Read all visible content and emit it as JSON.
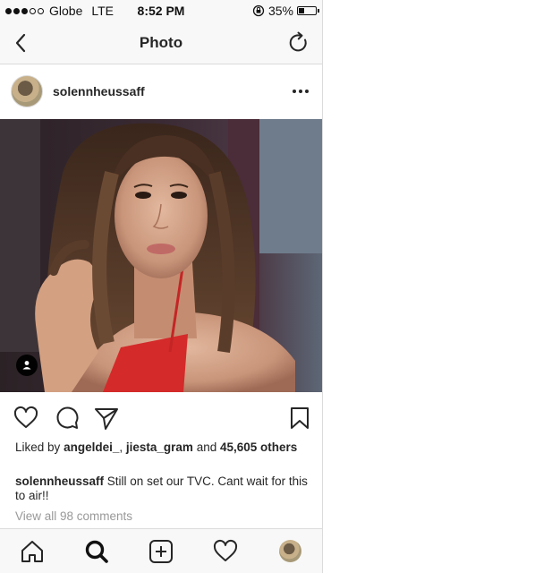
{
  "status_bar": {
    "carrier": "Globe",
    "network": "LTE",
    "time": "8:52 PM",
    "battery": "35%",
    "battery_level": 0.35,
    "signal_bars_filled": 3,
    "signal_bars_total": 5
  },
  "header": {
    "title": "Photo",
    "back_icon": "chevron-left-icon",
    "refresh_icon": "refresh-icon"
  },
  "post": {
    "username": "solennheussaff",
    "more_icon": "more-horizontal-icon",
    "likes": {
      "prefix": "Liked by",
      "user1": "angeldei_",
      "separator": ",",
      "user2": "jiesta_gram",
      "and": "and",
      "count": "45,605",
      "suffix": "others"
    },
    "caption": {
      "user": "solennheussaff",
      "text": "Still on set our TVC. Cant wait for this to air!!"
    },
    "view_comments": "View all 98 comments"
  },
  "actions": {
    "like_icon": "heart-icon",
    "comment_icon": "comment-icon",
    "share_icon": "send-icon",
    "save_icon": "bookmark-icon"
  },
  "tab_bar": {
    "items": [
      "home-icon",
      "search-icon",
      "add-icon",
      "activity-heart-icon",
      "profile-avatar"
    ]
  },
  "colors": {
    "bar_bg": "#f8f8f8",
    "border": "#dbdbdb",
    "text": "#262626",
    "muted": "#999999",
    "dress_red": "#d42a2a"
  }
}
